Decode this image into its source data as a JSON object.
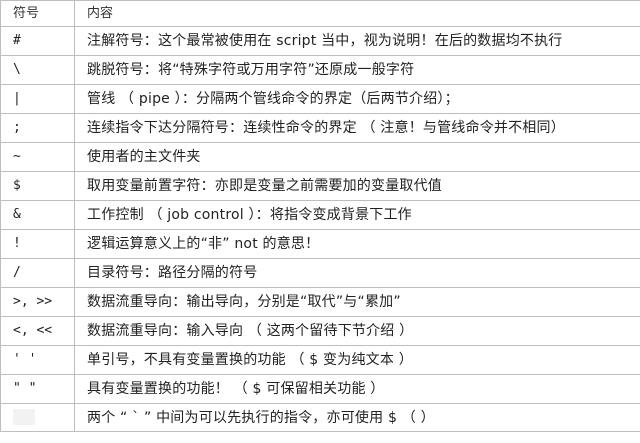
{
  "table": {
    "headers": {
      "symbol": "符号",
      "content": "内容"
    },
    "rows": [
      {
        "symbol": "#",
        "content": "注解符号：这个最常被使用在 script 当中，视为说明！在后的数据均不执行"
      },
      {
        "symbol": "\\",
        "content": "跳脱符号：将“特殊字符或万用字符”还原成一般字符"
      },
      {
        "symbol": "|",
        "content": "管线 （ pipe ）：分隔两个管线命令的界定（后两节介绍）；"
      },
      {
        "symbol": ";",
        "content": "连续指令下达分隔符号：连续性命令的界定 （ 注意！与管线命令并不相同）"
      },
      {
        "symbol": "~",
        "content": "使用者的主文件夹"
      },
      {
        "symbol": "$",
        "content": "取用变量前置字符：亦即是变量之前需要加的变量取代值"
      },
      {
        "symbol": "&",
        "content": "工作控制 （ job control ）：将指令变成背景下工作"
      },
      {
        "symbol": "!",
        "content": "逻辑运算意义上的“非” not 的意思！"
      },
      {
        "symbol": "/",
        "content": "目录符号：路径分隔的符号"
      },
      {
        "symbol": ">, >>",
        "content": "数据流重导向：输出导向，分别是“取代”与“累加”"
      },
      {
        "symbol": "<, <<",
        "content": "数据流重导向：输入导向 （ 这两个留待下节介绍 ）"
      },
      {
        "symbol": "' '",
        "content": "单引号，不具有变量置换的功能 （ $ 变为纯文本 ）"
      },
      {
        "symbol": "\" \"",
        "content": "具有变量置换的功能！ （ $ 可保留相关功能 ）"
      },
      {
        "symbol": "",
        "content": "两个 “ ` ” 中间为可以先执行的指令，亦可使用 $ （ ）"
      }
    ]
  }
}
